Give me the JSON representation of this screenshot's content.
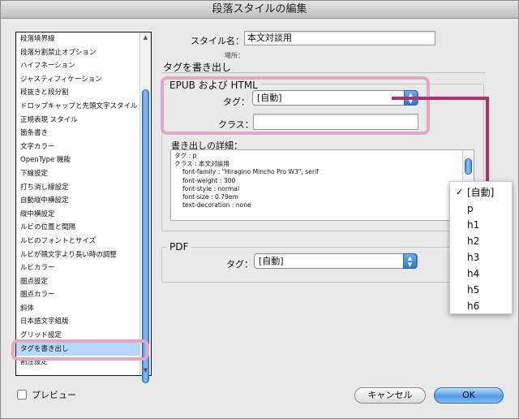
{
  "window": {
    "title": "段落スタイルの編集"
  },
  "style_list": {
    "items": [
      "段落境界線",
      "段落分割禁止オプション",
      "ハイフネーション",
      "ジャスティフィケーション",
      "段抜きと段分割",
      "ドロップキャップと先頭文字スタイル",
      "正規表現 スタイル",
      "箇条書き",
      "文字カラー",
      "OpenType 機能",
      "下線設定",
      "打ち消し線設定",
      "自動縦中横設定",
      "縦中横設定",
      "ルビの位置と間隔",
      "ルビのフォントとサイズ",
      "ルビが親文字より長い時の調整",
      "ルビカラー",
      "圏点設定",
      "圏点カラー",
      "斜体",
      "日本語文字組版",
      "グリッド設定",
      "タグを書き出し",
      "割注設定"
    ],
    "selected_index": 23
  },
  "preview": {
    "label": "プレビュー",
    "checked": false
  },
  "form": {
    "style_name_label": "スタイル名：",
    "style_name_value": "本文対談用",
    "location_label": "場所：",
    "section_title": "タグを書き出し"
  },
  "epub": {
    "group_title": "EPUB および HTML",
    "tag_label": "タグ：",
    "tag_value": "[自動]",
    "class_label": "クラス：",
    "class_value": "",
    "details_title": "書き出しの詳細：",
    "details": [
      "タグ : p",
      "クラス : 本文対談用",
      "font-family : \"Hiragino Mincho Pro W3\", serif",
      "font-weight : 300",
      "font-style : normal",
      "font-size : 0.79em",
      "text-decoration : none"
    ]
  },
  "pdf": {
    "group_title": "PDF",
    "tag_label": "タグ：",
    "tag_value": "[自動]"
  },
  "tag_menu": {
    "options": [
      "[自動]",
      "p",
      "h1",
      "h2",
      "h3",
      "h4",
      "h5",
      "h6"
    ],
    "checked_index": 0,
    "check_glyph": "✓"
  },
  "buttons": {
    "cancel": "キャンセル",
    "ok": "OK"
  },
  "colors": {
    "highlight": "#e3a8c4",
    "connector": "#b0306a",
    "accent": "#2b78d8"
  }
}
